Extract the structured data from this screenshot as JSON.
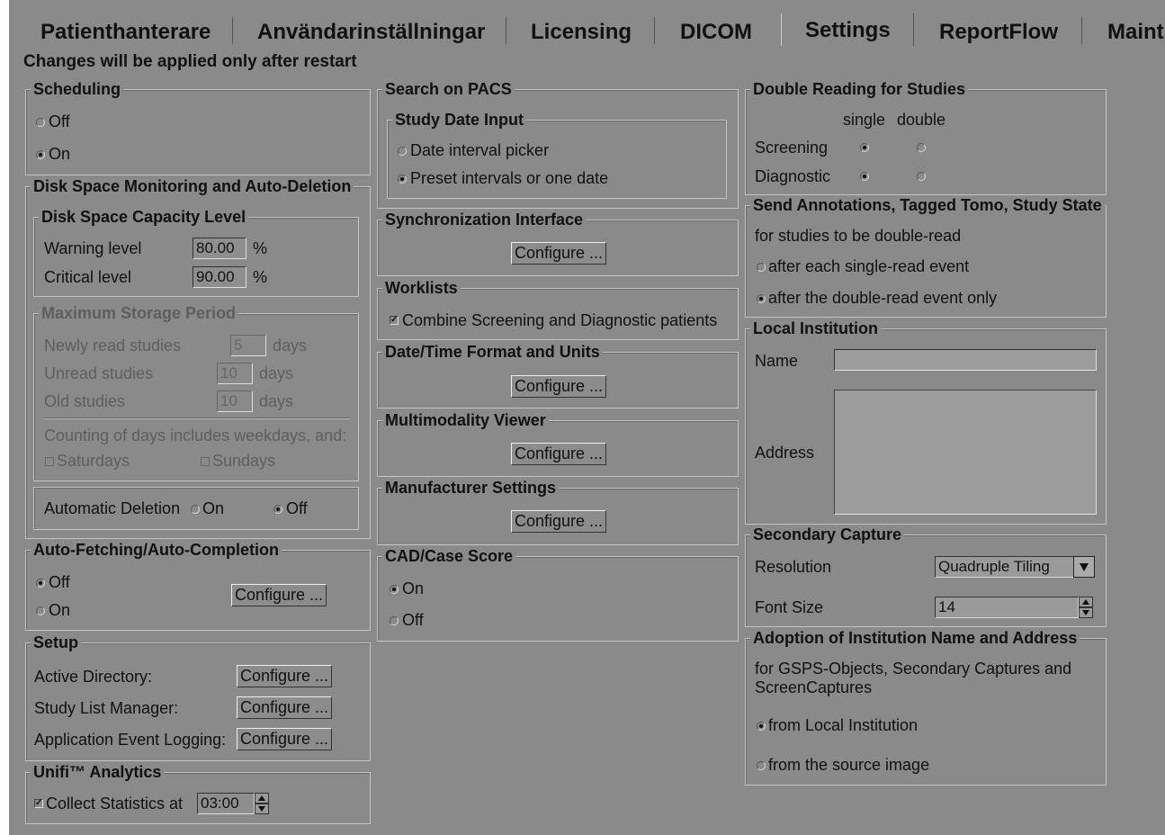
{
  "tabs": [
    "Patienthanterare",
    "Användarinställningar",
    "Licensing",
    "DICOM",
    "Settings",
    "ReportFlow",
    "Maint"
  ],
  "active_tab": "Settings",
  "notice": "Changes will be applied only after restart",
  "configure_label": "Configure ...",
  "scheduling": {
    "title": "Scheduling",
    "off": "Off",
    "on": "On",
    "selected": "On"
  },
  "disk": {
    "title": "Disk Space Monitoring and Auto-Deletion",
    "capacity": {
      "title": "Disk Space Capacity Level",
      "warning_label": "Warning level",
      "warning_value": "80.00",
      "critical_label": "Critical level",
      "critical_value": "90.00",
      "unit": "%"
    },
    "storage": {
      "title": "Maximum Storage Period",
      "newly_label": "Newly read studies",
      "newly_value": "5",
      "unread_label": "Unread studies",
      "unread_value": "10",
      "old_label": "Old studies",
      "old_value": "10",
      "days": "days",
      "counting": "Counting of days includes weekdays, and:",
      "saturdays": "Saturdays",
      "sundays": "Sundays"
    },
    "auto_deletion": {
      "label": "Automatic Deletion",
      "on": "On",
      "off": "Off",
      "selected": "Off"
    }
  },
  "autofetch": {
    "title": "Auto-Fetching/Auto-Completion",
    "off": "Off",
    "on": "On",
    "selected": "Off"
  },
  "setup": {
    "title": "Setup",
    "active_directory": "Active Directory:",
    "study_list": "Study List Manager:",
    "event_logging": "Application Event Logging:"
  },
  "unifi": {
    "title": "Unifi™ Analytics",
    "collect_label": "Collect Statistics at",
    "time": "03:00",
    "checked": true
  },
  "pacs": {
    "title": "Search on PACS",
    "study_date": {
      "title": "Study Date Input",
      "picker": "Date interval picker",
      "preset": "Preset intervals or one date",
      "selected": "preset"
    }
  },
  "sync": {
    "title": "Synchronization Interface"
  },
  "worklists": {
    "title": "Worklists",
    "combine": "Combine Screening and Diagnostic patients",
    "checked": true
  },
  "datetime": {
    "title": "Date/Time Format and Units"
  },
  "multimodality": {
    "title": "Multimodality Viewer"
  },
  "manufacturer": {
    "title": "Manufacturer Settings"
  },
  "cad": {
    "title": "CAD/Case Score",
    "on": "On",
    "off": "Off",
    "selected": "On"
  },
  "double_reading": {
    "title": "Double Reading for Studies",
    "single": "single",
    "double": "double",
    "screening": "Screening",
    "diagnostic": "Diagnostic",
    "screening_selected": "single",
    "diagnostic_selected": "single"
  },
  "annotations": {
    "title": "Send Annotations, Tagged Tomo, Study State",
    "desc": "for studies to be double-read",
    "after_each": "after each single-read event",
    "after_double": "after the double-read event only",
    "selected": "after_double"
  },
  "institution": {
    "title": "Local Institution",
    "name_label": "Name",
    "name_value": "",
    "address_label": "Address",
    "address_value": ""
  },
  "secondary": {
    "title": "Secondary Capture",
    "resolution_label": "Resolution",
    "resolution_value": "Quadruple Tiling",
    "font_label": "Font Size",
    "font_value": "14"
  },
  "adoption": {
    "title": "Adoption of Institution Name and Address",
    "desc1": "for GSPS-Objects, Secondary Captures and",
    "desc2": "ScreenCaptures",
    "from_local": "from Local Institution",
    "from_source": "from the source image",
    "selected": "local"
  }
}
